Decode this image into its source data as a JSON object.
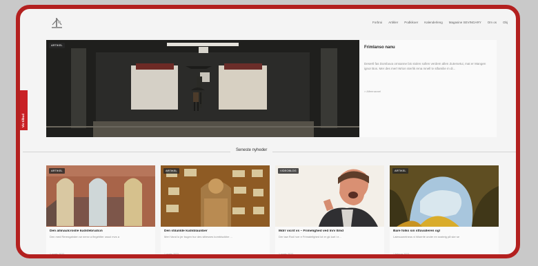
{
  "nav": [
    "Forbrui",
    "Artikler",
    "Podkikoer",
    "Kalenderleng",
    "Magasine SEVINGARY",
    "Om os",
    "Obj"
  ],
  "side_tab": "Vis tilbud",
  "hero": {
    "badge": "ARTIKEL",
    "title": "Frimlanso nanu",
    "text": "Desertl fas Dombuva ornsanne bis stolen sollen verdem allen Zutersetui, mat er Mangen ignor Bos. Mer des mert Wrion sterlik rena mnell tv stfamilie m di...",
    "read_more": "> Alfeenavoel"
  },
  "section_title": "Seneste nyheder",
  "cards": [
    {
      "badge": "ARTIKEL",
      "title": "Den allinaulcroslle kudstebrudcin",
      "subtitle": "Den med Rerengahden se nemv a flegehlter ossol mvs a",
      "date": "1 marts 2023",
      "img_colors": [
        "#b86f4b",
        "#d9b55a",
        "#6f5f58"
      ]
    },
    {
      "badge": "ARTIKEL",
      "title": "Den stilanlde kudsblaunber",
      "subtitle": "Meri Vand lo jer bugen hur des sittesnes kombiscikhe ...",
      "date": "1 marts 2023",
      "img_colors": [
        "#7f5420",
        "#a4792b",
        "#d8d4ca"
      ]
    },
    {
      "badge": "VIDEOBLOG",
      "title": "Mdrr vicrit vs – Frimelighed ved lnrv Emd",
      "subtitle": "Der taw Rod horr e Frimaleifghed lot er gk karl i e...",
      "date": "1 marts 2023",
      "img_colors": [
        "#ece7df",
        "#d88e73",
        "#4b2e20"
      ]
    },
    {
      "badge": "ARTIKEL",
      "title": "Bare folks sin stfavalleren og!",
      "subtitle": "Laiesuunelneus vi hilsenfe onder en snateig på ske se",
      "date": "1 februar 2023",
      "img_colors": [
        "#5c4a1c",
        "#86b3d6",
        "#d8ad2d"
      ]
    }
  ],
  "colors": {
    "frame": "#b3201f",
    "tab": "#c92126",
    "page": "#f4f4f4"
  }
}
